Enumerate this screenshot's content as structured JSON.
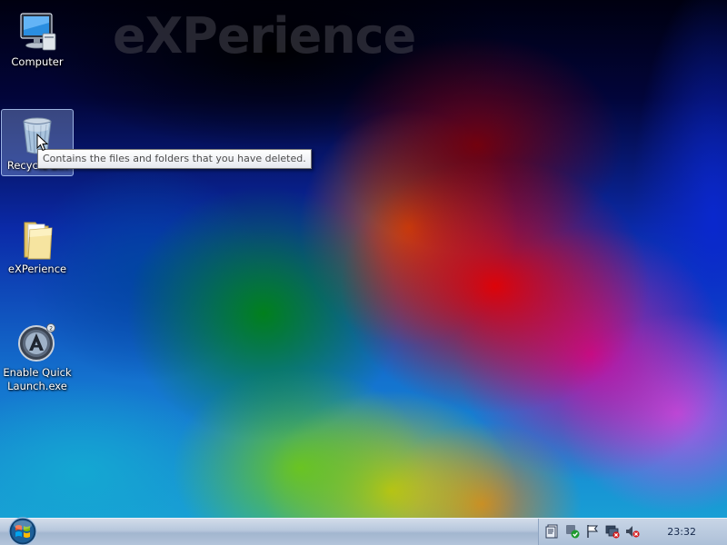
{
  "wallpaper": {
    "watermark_text": "eXPerience"
  },
  "desktop_icons": [
    {
      "label": "Computer",
      "icon": "computer-icon"
    },
    {
      "label": "Recycle Bin",
      "icon": "recycle-bin-icon",
      "selected": true
    },
    {
      "label": "eXPerience",
      "icon": "folder-icon"
    },
    {
      "label": "Enable Quick\nLaunch.exe",
      "icon": "quick-launch-app-icon"
    }
  ],
  "tooltip": {
    "text": "Contains the files and folders that you have deleted."
  },
  "taskbar": {
    "start_button": "start-orb-icon",
    "tray_icons": [
      "document-tray-icon",
      "security-shield-tray-icon",
      "action-center-flag-icon",
      "network-disconnected-icon",
      "volume-muted-icon"
    ],
    "clock": "23:32"
  },
  "colors": {
    "taskbar": "#b7c7dc",
    "tooltip_border": "#767676",
    "selection": "#a0bef0"
  }
}
